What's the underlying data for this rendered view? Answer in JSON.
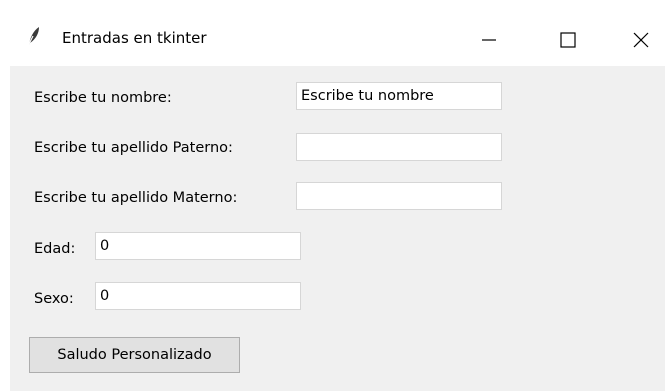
{
  "window": {
    "title": "Entradas en tkinter",
    "app_icon": "feather-icon",
    "controls": [
      "minimize-icon",
      "maximize-icon",
      "close-icon"
    ]
  },
  "form": {
    "nombre": {
      "label": "Escribe tu nombre:",
      "value": "Escribe tu nombre"
    },
    "paterno": {
      "label": "Escribe tu apellido Paterno:",
      "value": ""
    },
    "materno": {
      "label": "Escribe tu apellido Materno:",
      "value": ""
    },
    "edad": {
      "label": "Edad:",
      "value": "0"
    },
    "sexo": {
      "label": "Sexo:",
      "value": "0"
    }
  },
  "actions": {
    "saludo_label": "Saludo Personalizado"
  }
}
